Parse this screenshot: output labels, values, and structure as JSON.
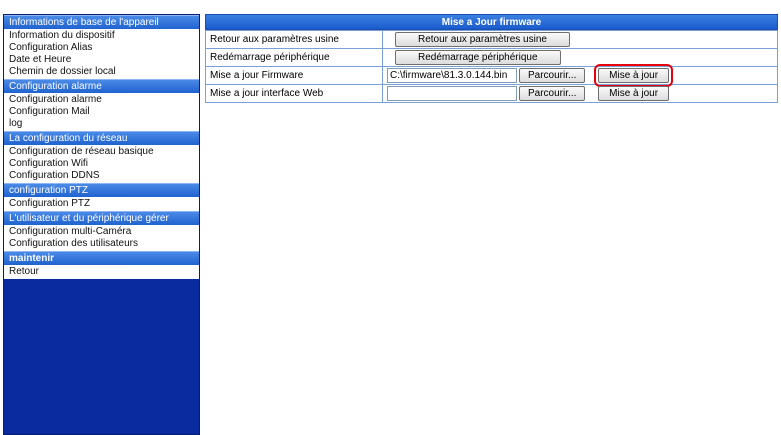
{
  "sidebar": {
    "sections": [
      {
        "header": "Informations de base de l'appareil",
        "items": [
          "Information du dispositif",
          "Configuration Alias",
          "Date et Heure",
          "Chemin de dossier local"
        ]
      },
      {
        "header": "Configuration alarme",
        "items": [
          "Configuration alarme",
          "Configuration Mail",
          "log"
        ]
      },
      {
        "header": "La configuration du réseau",
        "items": [
          "Configuration de réseau basique",
          "Configuration Wifi",
          "Configuration DDNS"
        ]
      },
      {
        "header": "configuration PTZ",
        "items": [
          "Configuration PTZ"
        ]
      },
      {
        "header": "L'utilisateur et du périphérique gérer",
        "items": [
          "Configuration multi-Caméra",
          "Configuration des utilisateurs"
        ]
      },
      {
        "header": "maintenir",
        "items": [
          "Retour"
        ]
      }
    ]
  },
  "main": {
    "title": "Mise a Jour firmware",
    "rows": {
      "factory_reset": {
        "label": "Retour aux paramètres usine",
        "button": "Retour aux paramètres usine"
      },
      "reboot": {
        "label": "Redémarrage périphérique",
        "button": "Redémarrage périphérique"
      },
      "firmware": {
        "label": "Mise a jour Firmware",
        "file_value": "C:\\firmware\\81.3.0.144.bin",
        "browse": "Parcourir...",
        "update": "Mise à jour"
      },
      "webui": {
        "label": "Mise a jour interface Web",
        "file_value": "",
        "browse": "Parcourir...",
        "update": "Mise à jour"
      }
    }
  },
  "colors": {
    "sidebar_bg": "#0a2aa0",
    "header_bg": "#3a7fe0",
    "highlight": "#e8000b"
  }
}
